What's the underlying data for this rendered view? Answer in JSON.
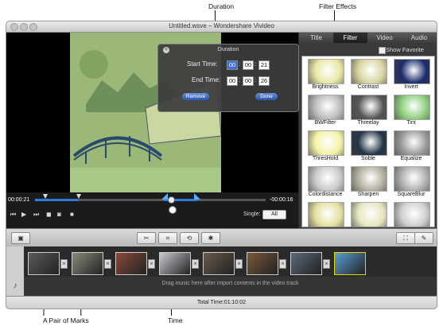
{
  "callouts": {
    "duration": "Duration",
    "filter_effects": "Filter Effects",
    "pair_of_marks": "A Pair of Marks",
    "time": "Time"
  },
  "window": {
    "title": "Untitled.wsve – Wondershare Vivideo"
  },
  "duration_dialog": {
    "title": "Duration",
    "start_label": "Start Time:",
    "start": [
      "00",
      "00",
      "21"
    ],
    "end_label": "End Time:",
    "end": [
      "00",
      "00",
      "26"
    ],
    "remove_label": "Remove",
    "done_label": "Done"
  },
  "tabs": [
    "Title",
    "Filter",
    "Video",
    "Audio"
  ],
  "active_tab": "Filter",
  "show_favorite": "Show Favorite",
  "effects": [
    {
      "name": "Brightness",
      "color": "#e9e7a5"
    },
    {
      "name": "Contrast",
      "color": "#d9d4a0"
    },
    {
      "name": "Invert",
      "color": "#1c2b6b"
    },
    {
      "name": "BWFilter",
      "color": "#bdbdbd"
    },
    {
      "name": "Threelay",
      "color": "#555555"
    },
    {
      "name": "Tint",
      "color": "#8fd07f"
    },
    {
      "name": "ThresHold",
      "color": "#f5f2a8"
    },
    {
      "name": "Soble",
      "color": "#223344"
    },
    {
      "name": "Equalize",
      "color": "#9a9a9a"
    },
    {
      "name": "Colordistance",
      "color": "#c9c9c9"
    },
    {
      "name": "Sharpen",
      "color": "#b5b0a0"
    },
    {
      "name": "SquareBlur",
      "color": "#b0b0b0"
    },
    {
      "name": "",
      "color": "#e6e0a0"
    },
    {
      "name": "",
      "color": "#e8e6c0"
    },
    {
      "name": "",
      "color": "#cfcfcf"
    }
  ],
  "timeline": {
    "current_time": "00:00:21",
    "remaining_time": "-00:00:16",
    "single_label": "Single:",
    "all_label": "All"
  },
  "music_hint": "Drag music here after import contents in the video track",
  "total_time": "Total Time:01:10:02",
  "clips": [
    "#5a5a5a",
    "#8a8a7a",
    "#8a4a3a",
    "#c8c8d0",
    "#6a5a4a",
    "#7a5a3a",
    "#5a6a7a",
    "#5aa0d8"
  ]
}
